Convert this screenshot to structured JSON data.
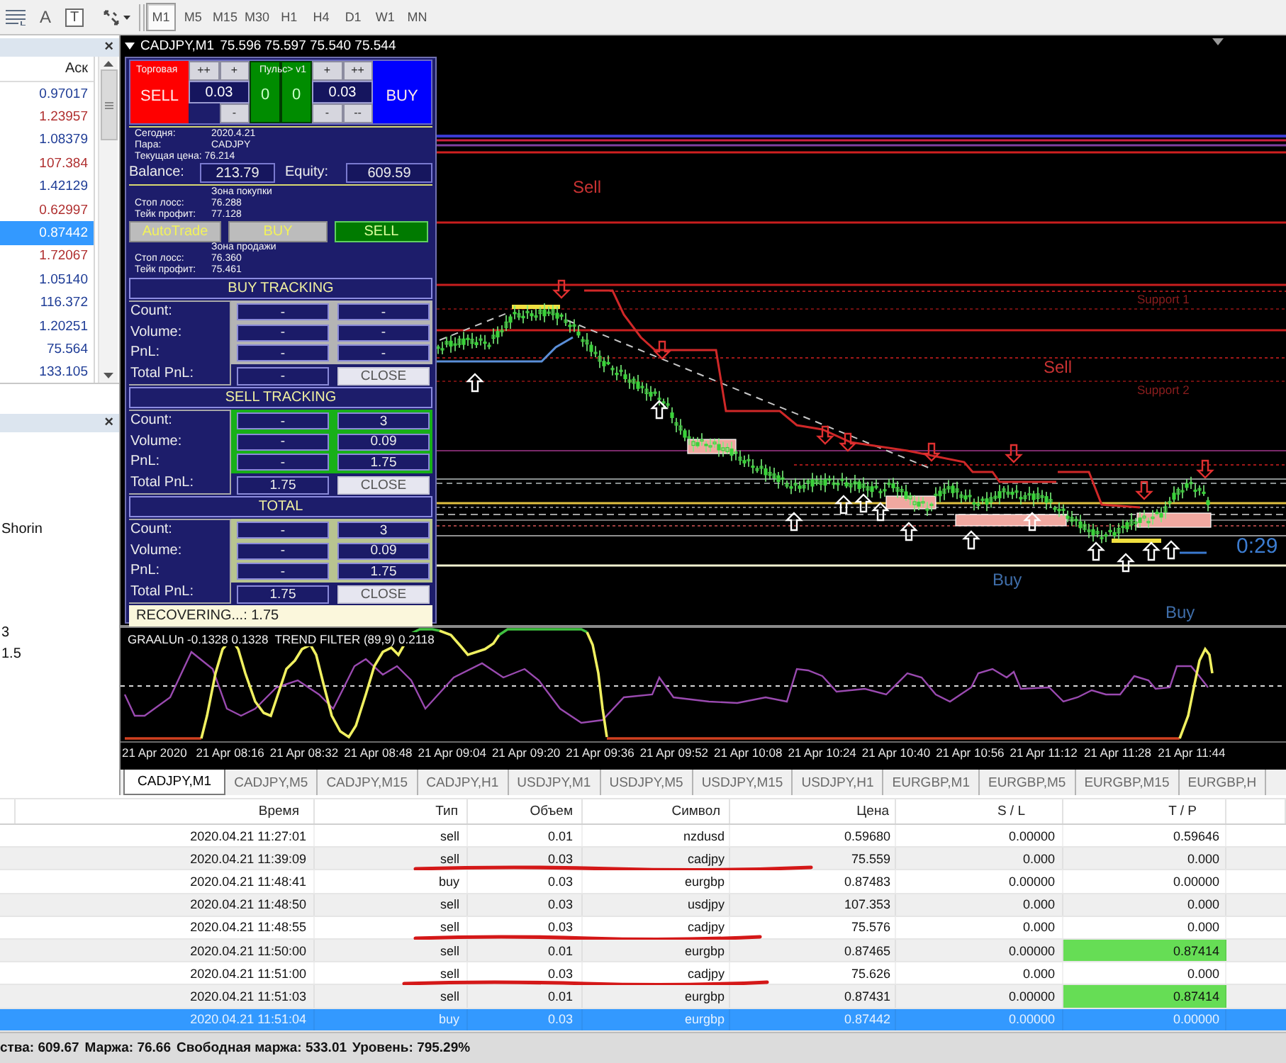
{
  "toolbar": {
    "tools": [
      {
        "kind": "lines"
      },
      {
        "kind": "glyph",
        "label": "A"
      },
      {
        "kind": "boxed",
        "label": "T"
      },
      {
        "kind": "arrows"
      }
    ],
    "timeframes": [
      {
        "label": "M1",
        "selected": true
      },
      {
        "label": "M5",
        "selected": false
      },
      {
        "label": "M15",
        "selected": false
      },
      {
        "label": "M30",
        "selected": false
      },
      {
        "label": "H1",
        "selected": false
      },
      {
        "label": "H4",
        "selected": false
      },
      {
        "label": "D1",
        "selected": false
      },
      {
        "label": "W1",
        "selected": false
      },
      {
        "label": "MN",
        "selected": false
      }
    ]
  },
  "market_watch": {
    "close": "×",
    "column": "Аск",
    "rows": [
      {
        "ask": "0.97017",
        "color": "#1e3c96",
        "selected": false
      },
      {
        "ask": "1.23957",
        "color": "#b03030",
        "selected": false
      },
      {
        "ask": "1.08379",
        "color": "#1e3c96",
        "selected": false
      },
      {
        "ask": "107.384",
        "color": "#b03030",
        "selected": false
      },
      {
        "ask": "1.42129",
        "color": "#1e3c96",
        "selected": false
      },
      {
        "ask": "0.62997",
        "color": "#b03030",
        "selected": false
      },
      {
        "ask": "0.87442",
        "selected": true
      },
      {
        "ask": "1.72067",
        "color": "#b03030",
        "selected": false
      },
      {
        "ask": "1.05140",
        "color": "#1e3c96",
        "selected": false
      },
      {
        "ask": "116.372",
        "color": "#1e3c96",
        "selected": false
      },
      {
        "ask": "1.20251",
        "color": "#1e3c96",
        "selected": false
      },
      {
        "ask": "75.564",
        "color": "#1e3c96",
        "selected": false
      },
      {
        "ask": "133.105",
        "color": "#1e3c96",
        "selected": false
      }
    ]
  },
  "navigator": {
    "close": "×",
    "items": [
      "Shorin",
      "3",
      "1.5"
    ]
  },
  "chart": {
    "title": "CADJPY,M1",
    "quote": "75.596 75.597 75.540 75.544",
    "panel": {
      "overlay_text": [
        "Торговая",
        "Пульс> v1",
        "Сегодня:",
        "2020.4.21",
        "Пара:",
        "CADJPY",
        "Текущая цена: 76.214",
        "Зона покупки",
        "Стоп лосс:",
        "76.288",
        "Тейк профит:",
        "77.128",
        "Зона продажи",
        "Стоп лосс:",
        "76.360",
        "Тейк профит:",
        "75.461"
      ],
      "order_row": [
        {
          "kind": "sell",
          "label": "SELL"
        },
        {
          "kind": "stepper",
          "top": [
            "++",
            "+"
          ],
          "value": "0.03",
          "bottom": [
            "-"
          ]
        },
        {
          "kind": "counters",
          "values": [
            "0",
            "0"
          ]
        },
        {
          "kind": "stepper",
          "top": [
            "+",
            "++"
          ],
          "value": "0.03",
          "bottom": [
            "-",
            "--"
          ]
        },
        {
          "kind": "buy",
          "label": "BUY"
        }
      ],
      "balance_label": "Balance:",
      "balance": "213.79",
      "equity_label": "Equity:",
      "equity": "609.59",
      "actions": [
        {
          "label": "AutoTrade",
          "kind": "neutral"
        },
        {
          "label": "BUY",
          "kind": "neutral"
        },
        {
          "label": "SELL",
          "kind": "active"
        }
      ],
      "sections": [
        {
          "title": "BUY TRACKING",
          "kind": "buy",
          "rows": [
            {
              "label": "Count:",
              "values": [
                "-",
                "-"
              ]
            },
            {
              "label": "Volume:",
              "values": [
                "-",
                "-"
              ]
            },
            {
              "label": "PnL:",
              "values": [
                "-",
                "-"
              ]
            }
          ],
          "total_label": "Total PnL:",
          "total": "-",
          "close": "CLOSE"
        },
        {
          "title": "SELL TRACKING",
          "kind": "sell",
          "rows": [
            {
              "label": "Count:",
              "values": [
                "-",
                "3"
              ]
            },
            {
              "label": "Volume:",
              "values": [
                "-",
                "0.09"
              ]
            },
            {
              "label": "PnL:",
              "values": [
                "-",
                "1.75"
              ]
            }
          ],
          "total_label": "Total PnL:",
          "total": "1.75",
          "close": "CLOSE"
        },
        {
          "title": "TOTAL",
          "kind": "total",
          "rows": [
            {
              "label": "Count:",
              "values": [
                "-",
                "3"
              ]
            },
            {
              "label": "Volume:",
              "values": [
                "-",
                "0.09"
              ]
            },
            {
              "label": "PnL:",
              "values": [
                "-",
                "1.75"
              ]
            }
          ],
          "total_label": "Total PnL:",
          "total": "1.75",
          "close": "CLOSE"
        }
      ],
      "status": "RECOVERING...: 1.75"
    },
    "labels": [
      {
        "kind": "signal",
        "text": "Sell",
        "color": "#c83232"
      },
      {
        "kind": "level",
        "text": "Support 1",
        "color": "#8c1e1e"
      },
      {
        "kind": "signal",
        "text": "Sell",
        "color": "#c83232"
      },
      {
        "kind": "level",
        "text": "Support 2",
        "color": "#8c1e1e"
      },
      {
        "kind": "timer",
        "text": "0:29",
        "color": "#3c7cd0"
      },
      {
        "kind": "signal",
        "text": "Buy",
        "color": "#3f6eaa"
      },
      {
        "kind": "signal",
        "text": "Buy",
        "color": "#3f6eaa"
      }
    ],
    "indicator": {
      "title": "GRAALUn -0.1328 0.1328  TREND FILTER (89,9) 0.2118"
    },
    "time_axis": [
      "21 Apr 2020",
      "21 Apr 08:16",
      "21 Apr 08:32",
      "21 Apr 08:48",
      "21 Apr 09:04",
      "21 Apr 09:20",
      "21 Apr 09:36",
      "21 Apr 09:52",
      "21 Apr 10:08",
      "21 Apr 10:24",
      "21 Apr 10:40",
      "21 Apr 10:56",
      "21 Apr 11:12",
      "21 Apr 11:28",
      "21 Apr 11:44"
    ]
  },
  "chart_tabs": [
    {
      "label": "CADJPY,M1",
      "selected": true
    },
    {
      "label": "CADJPY,M5",
      "selected": false
    },
    {
      "label": "CADJPY,M15",
      "selected": false
    },
    {
      "label": "CADJPY,H1",
      "selected": false
    },
    {
      "label": "USDJPY,M1",
      "selected": false
    },
    {
      "label": "USDJPY,M5",
      "selected": false
    },
    {
      "label": "USDJPY,M15",
      "selected": false
    },
    {
      "label": "USDJPY,H1",
      "selected": false
    },
    {
      "label": "EURGBP,M1",
      "selected": false
    },
    {
      "label": "EURGBP,M5",
      "selected": false
    },
    {
      "label": "EURGBP,M15",
      "selected": false
    },
    {
      "label": "EURGBP,H",
      "selected": false
    }
  ],
  "orders": {
    "columns": [
      "Время",
      "Тип",
      "Объем",
      "Символ",
      "Цена",
      "S / L",
      "T / P"
    ],
    "rows": [
      {
        "cells": [
          "2020.04.21 11:27:01",
          "sell",
          "0.01",
          "nzdusd",
          "0.59680",
          "0.00000",
          "0.59646"
        ],
        "tp_hit": false,
        "underlined": false,
        "selected": false
      },
      {
        "cells": [
          "2020.04.21 11:39:09",
          "sell",
          "0.03",
          "cadjpy",
          "75.559",
          "0.000",
          "0.000"
        ],
        "tp_hit": false,
        "underlined": true,
        "selected": false
      },
      {
        "cells": [
          "2020.04.21 11:48:41",
          "buy",
          "0.03",
          "eurgbp",
          "0.87483",
          "0.00000",
          "0.00000"
        ],
        "tp_hit": false,
        "underlined": false,
        "selected": false
      },
      {
        "cells": [
          "2020.04.21 11:48:50",
          "sell",
          "0.03",
          "usdjpy",
          "107.353",
          "0.000",
          "0.000"
        ],
        "tp_hit": false,
        "underlined": false,
        "selected": false
      },
      {
        "cells": [
          "2020.04.21 11:48:55",
          "sell",
          "0.03",
          "cadjpy",
          "75.576",
          "0.000",
          "0.000"
        ],
        "tp_hit": false,
        "underlined": true,
        "selected": false
      },
      {
        "cells": [
          "2020.04.21 11:50:00",
          "sell",
          "0.01",
          "eurgbp",
          "0.87465",
          "0.00000",
          "0.87414"
        ],
        "tp_hit": true,
        "underlined": false,
        "selected": false
      },
      {
        "cells": [
          "2020.04.21 11:51:00",
          "sell",
          "0.03",
          "cadjpy",
          "75.626",
          "0.000",
          "0.000"
        ],
        "tp_hit": false,
        "underlined": true,
        "selected": false
      },
      {
        "cells": [
          "2020.04.21 11:51:03",
          "sell",
          "0.01",
          "eurgbp",
          "0.87431",
          "0.00000",
          "0.87414"
        ],
        "tp_hit": true,
        "underlined": false,
        "selected": false
      },
      {
        "cells": [
          "2020.04.21 11:51:04",
          "buy",
          "0.03",
          "eurgbp",
          "0.87442",
          "0.00000",
          "0.00000"
        ],
        "tp_hit": false,
        "underlined": false,
        "selected": true
      }
    ]
  },
  "status_bar": [
    "ства: 609.67",
    "Маржа: 76.66",
    "Свободная маржа: 533.01",
    "Уровень: 795.29%"
  ]
}
